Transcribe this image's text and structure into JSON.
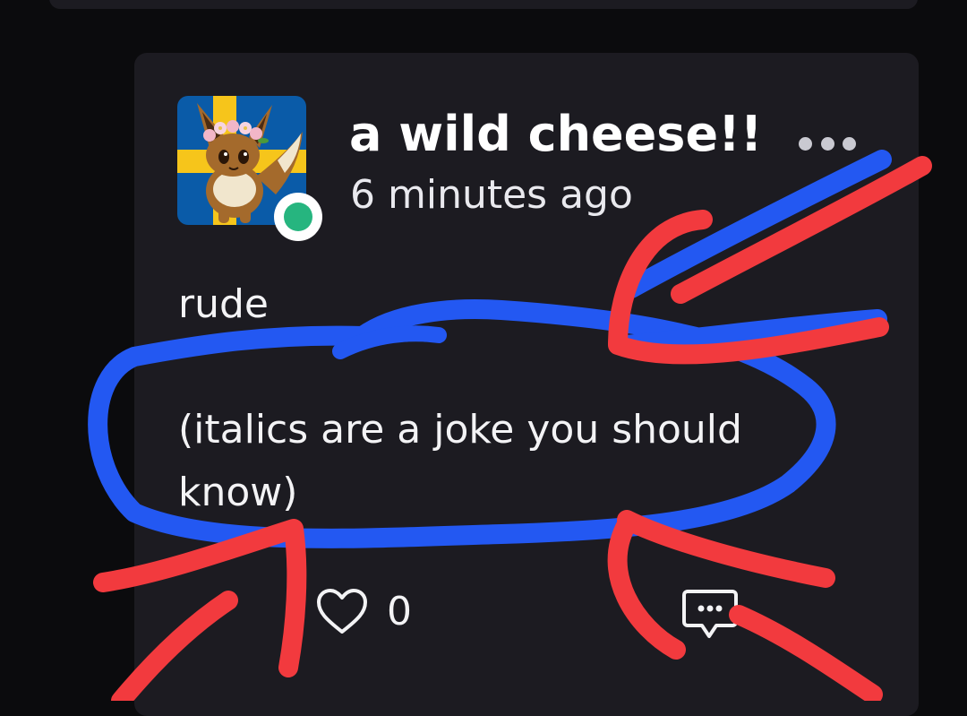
{
  "post": {
    "username": "a wild cheese!!",
    "timestamp": "6 minutes ago",
    "body_line1": "rude",
    "body_line2": "(italics are a joke you should know)",
    "like_count": "0",
    "icons": {
      "more": "more-dots-icon",
      "like": "heart-icon",
      "reply": "comment-bubble-icon"
    },
    "status": "online"
  },
  "colors": {
    "background": "#0b0b0d",
    "card": "#1c1b21",
    "online_indicator": "#26b57f",
    "annotation_blue": "#2358f2",
    "annotation_red": "#f23a3e"
  }
}
